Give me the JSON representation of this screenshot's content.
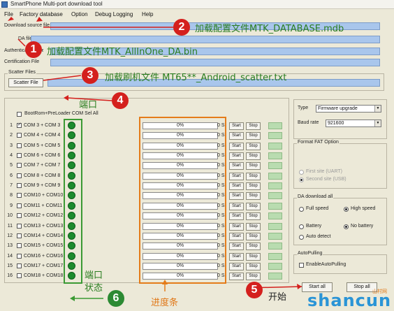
{
  "window": {
    "title": "SmartPhone Multi-port download tool"
  },
  "menu": [
    "File",
    "Factory database",
    "Option",
    "Debug Logging",
    "Help"
  ],
  "fields": {
    "download_source": "Download source file",
    "da_file": "DA file",
    "auth_file": "Authentication File",
    "cert_file": "Certification File"
  },
  "scatter": {
    "group_title": "Scatter Files",
    "button": "Scatter File"
  },
  "ports": {
    "select_all_label": "BootRom+PreLoader COM Sel All",
    "rows": [
      {
        "num": "1",
        "label": "COM 3 + COM 3",
        "checked": true
      },
      {
        "num": "2",
        "label": "COM 4 + COM 4",
        "checked": false
      },
      {
        "num": "3",
        "label": "COM 5 + COM 5",
        "checked": false
      },
      {
        "num": "4",
        "label": "COM 6 + COM 6",
        "checked": false
      },
      {
        "num": "5",
        "label": "COM 7 + COM 7",
        "checked": false
      },
      {
        "num": "6",
        "label": "COM 8 + COM 8",
        "checked": false
      },
      {
        "num": "7",
        "label": "COM 9 + COM 9",
        "checked": false
      },
      {
        "num": "8",
        "label": "COM10 + COM10",
        "checked": false
      },
      {
        "num": "9",
        "label": "COM11 + COM11",
        "checked": false
      },
      {
        "num": "10",
        "label": "COM12 + COM12",
        "checked": false
      },
      {
        "num": "11",
        "label": "COM13 + COM13",
        "checked": false
      },
      {
        "num": "12",
        "label": "COM14 + COM14",
        "checked": false
      },
      {
        "num": "13",
        "label": "COM15 + COM15",
        "checked": false
      },
      {
        "num": "14",
        "label": "COM16 + COM16",
        "checked": false
      },
      {
        "num": "15",
        "label": "COM17 + COM17",
        "checked": false
      },
      {
        "num": "16",
        "label": "COM18 + COM18",
        "checked": false
      }
    ],
    "progress_text": "0%",
    "time_text": "0 S",
    "start_label": "Start",
    "stop_label": "Stop",
    "status_color": "#1d8b2e"
  },
  "settings": {
    "type_label": "Type",
    "type_value": "Firmware upgrade",
    "baud_label": "Baud rate",
    "baud_value": "921600",
    "format_title": "Format FAT Option",
    "first_site": "First site (UART)",
    "second_site": "Second site (USB)",
    "da_title": "DA download all",
    "full_speed": "Full speed",
    "high_speed": "High speed",
    "battery": "Battery",
    "no_battery": "No battery",
    "auto_detect": "Auto detect",
    "autopull_title": "AutoPulling",
    "autopull_label": "EnableAutoPulling",
    "start_all": "Start all",
    "stop_all": "Stop all"
  },
  "annotations": {
    "n1": "1",
    "n2": "2",
    "n3": "3",
    "n4": "4",
    "n5": "5",
    "n6": "6",
    "a1": "加载配置文件MTK_AllInOne_DA.bin",
    "a2": "加载配置文件MTK_DATABASE.mdb",
    "a3": "加载刷机文件 MT65**_Android_scatter.txt",
    "a4": "端口",
    "a5": "开始",
    "a6a": "端口",
    "a6b": "状态",
    "progress": "进度条",
    "colors": {
      "badge_red": "#d4201d",
      "badge_green": "#2c8a33",
      "box_green": "#3b9a34",
      "box_orange": "#e47c1a",
      "text_green": "#2a7d20"
    }
  },
  "watermark": {
    "text": "shancun",
    "sub": "山村网"
  }
}
